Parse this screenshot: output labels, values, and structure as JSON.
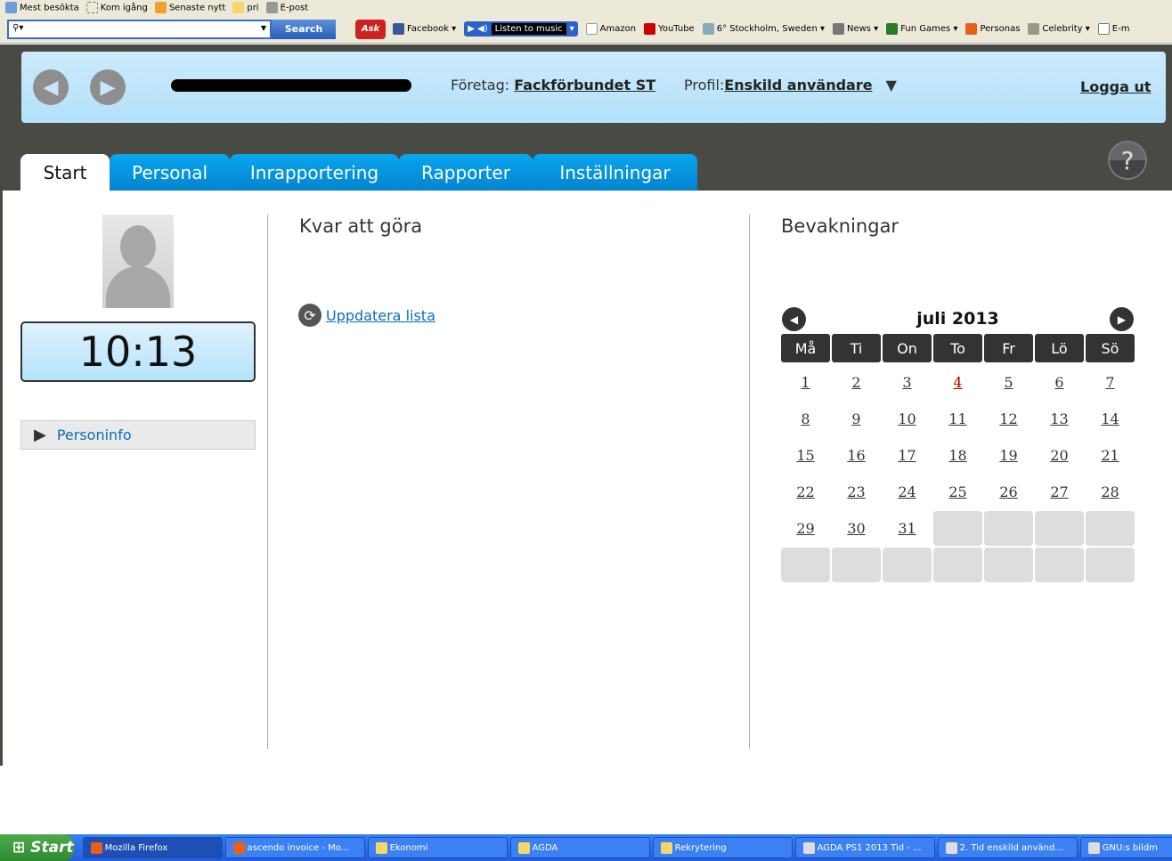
{
  "bookmarks": [
    "Mest besökta",
    "Kom igång",
    "Senaste nytt",
    "pri",
    "E-post"
  ],
  "toolbar": {
    "search_button": "Search",
    "items": [
      "Facebook ▾",
      "Listen to music",
      "Amazon",
      "YouTube",
      "6° Stockholm, Sweden ▾",
      "News ▾",
      "Fun Games ▾",
      "Personas",
      "Celebrity ▾",
      "E-m"
    ]
  },
  "header": {
    "company_label": "Företag:",
    "company": "Fackförbundet ST",
    "profile_label": "Profil:",
    "profile": "Enskild användare",
    "logout": "Logga ut"
  },
  "tabs": [
    "Start",
    "Personal",
    "Inrapportering",
    "Rapporter",
    "Inställningar"
  ],
  "help": "?",
  "left": {
    "clock": "10:13",
    "personinfo": "Personinfo"
  },
  "todo": {
    "title": "Kvar att göra",
    "refresh": "Uppdatera lista"
  },
  "watch": {
    "title": "Bevakningar"
  },
  "calendar": {
    "month": "juli 2013",
    "weekdays": [
      "Må",
      "Ti",
      "On",
      "To",
      "Fr",
      "Lö",
      "Sö"
    ],
    "days": [
      "1",
      "2",
      "3",
      "4",
      "5",
      "6",
      "7",
      "8",
      "9",
      "10",
      "11",
      "12",
      "13",
      "14",
      "15",
      "16",
      "17",
      "18",
      "19",
      "20",
      "21",
      "22",
      "23",
      "24",
      "25",
      "26",
      "27",
      "28",
      "29",
      "30",
      "31"
    ],
    "highlight_day": "4",
    "highlight_color": "#b00000"
  },
  "taskbar": {
    "start": "Start",
    "items": [
      "Mozilla Firefox",
      "ascendo invoice - Mo...",
      "Ekonomi",
      "AGDA",
      "Rekrytering",
      "AGDA PS1 2013 Tid - ...",
      "2. Tid enskild använd...",
      "GNU:s bildm"
    ]
  }
}
